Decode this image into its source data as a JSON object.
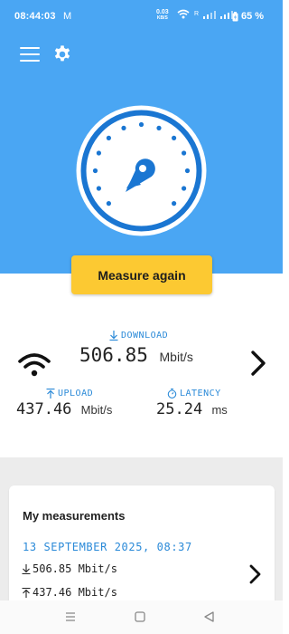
{
  "status_bar": {
    "time": "08:44:03",
    "mail_glyph": "M",
    "net_speed_value": "0.03",
    "net_speed_unit": "KB/S",
    "roaming": "R",
    "battery": "65 %"
  },
  "measure_button": "Measure again",
  "results": {
    "download_label": "DOWNLOAD",
    "download_value": "506.85",
    "download_unit": "Mbit/s",
    "upload_label": "UPLOAD",
    "upload_value": "437.46",
    "upload_unit": "Mbit/s",
    "latency_label": "LATENCY",
    "latency_value": "25.24",
    "latency_unit": "ms"
  },
  "measurements": {
    "title": "My measurements",
    "items": [
      {
        "date": "13 SEPTEMBER 2025, 08:37",
        "download": "506.85 Mbit/s",
        "upload": "437.46 Mbit/s"
      }
    ]
  },
  "icons": {
    "menu": "menu-icon",
    "settings": "gear-icon",
    "gauge": "speedometer-icon",
    "wifi": "wifi-icon",
    "next": "chevron-right-icon",
    "download": "download-arrow-icon",
    "upload": "upload-arrow-icon",
    "latency": "stopwatch-icon"
  },
  "colors": {
    "brand_blue": "#4aa6f3",
    "dial_blue": "#1a76d2",
    "accent_yellow": "#fcc932",
    "label_blue": "#2b8ad8"
  }
}
